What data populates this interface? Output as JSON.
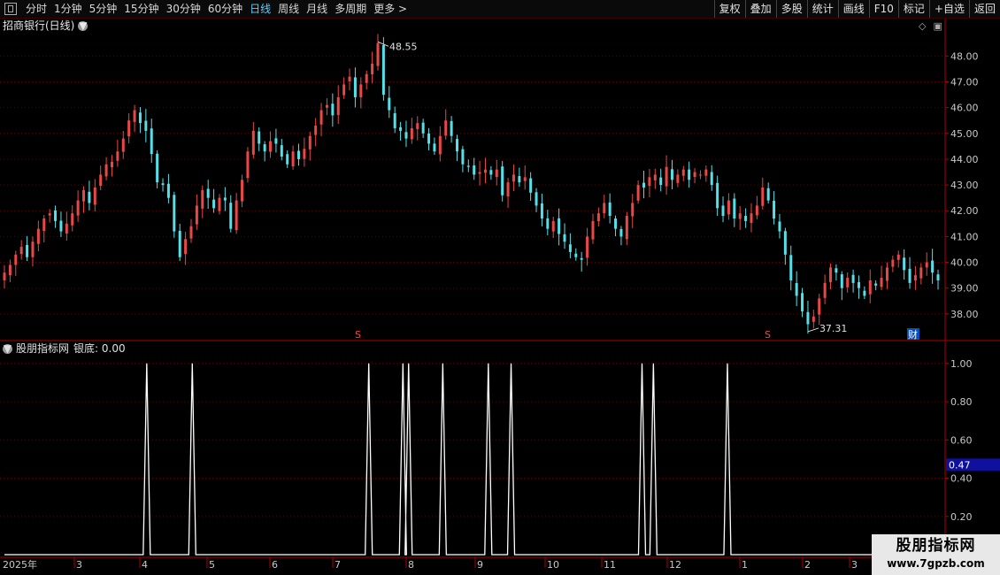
{
  "toolbar": {
    "timeframes": [
      "分时",
      "1分钟",
      "5分钟",
      "15分钟",
      "30分钟",
      "60分钟",
      "日线",
      "周线",
      "月线",
      "多周期",
      "更多 >"
    ],
    "active": "日线",
    "right_buttons": [
      "复权",
      "叠加",
      "多股",
      "统计",
      "画线",
      "F10",
      "标记",
      "+自选",
      "返回"
    ]
  },
  "chart_title": "招商银行(日线)",
  "indicator_title": "股朋指标网",
  "indicator_value_label": "银底: 0.00",
  "current_indicator_value": "0.47",
  "price_max_label": "48.55",
  "price_min_label": "37.31",
  "marker_s": "S",
  "marker_cai": "财",
  "watermark": {
    "line1": "股朋指标网",
    "line2": "www.7gpzb.com"
  },
  "colors": {
    "up": "#e84848",
    "down": "#54e0e8",
    "axis": "#b00000",
    "indicator": "#ffffff"
  },
  "chart_data": [
    {
      "type": "candlestick",
      "ylim": [
        37.0,
        48.8
      ],
      "y_ticks": [
        38.0,
        39.0,
        40.0,
        41.0,
        42.0,
        43.0,
        44.0,
        45.0,
        46.0,
        47.0,
        48.0
      ],
      "x_tick_labels": [
        "2025年",
        "3",
        "4",
        "5",
        "6",
        "7",
        "8",
        "9",
        "10",
        "11",
        "12",
        "1",
        "2",
        "3"
      ],
      "max": 48.55,
      "min": 37.31,
      "close": [
        39.6,
        39.9,
        40.3,
        40.6,
        40.2,
        40.8,
        41.3,
        41.7,
        41.9,
        41.6,
        41.2,
        41.5,
        41.9,
        42.4,
        42.8,
        42.3,
        42.9,
        43.4,
        43.8,
        43.9,
        44.3,
        44.8,
        45.5,
        45.9,
        45.4,
        45.1,
        44.2,
        43.1,
        43.0,
        42.5,
        41.2,
        40.2,
        40.9,
        41.4,
        42.2,
        42.8,
        42.5,
        42.1,
        42.5,
        42.4,
        41.3,
        42.4,
        43.2,
        44.3,
        45.1,
        44.6,
        44.3,
        44.7,
        44.6,
        44.1,
        43.8,
        44.3,
        44.0,
        44.4,
        44.9,
        45.3,
        45.9,
        46.1,
        45.7,
        46.4,
        46.9,
        47.2,
        46.4,
        46.9,
        47.3,
        47.7,
        48.5,
        46.5,
        45.9,
        45.2,
        45.1,
        44.8,
        45.2,
        45.4,
        45.0,
        44.6,
        44.3,
        44.9,
        45.5,
        44.9,
        44.3,
        43.8,
        43.7,
        43.4,
        43.5,
        43.6,
        43.4,
        43.6,
        42.6,
        43.1,
        43.4,
        43.1,
        43.3,
        42.7,
        42.2,
        41.7,
        41.3,
        41.6,
        41.1,
        40.8,
        40.4,
        40.2,
        40.1,
        41.0,
        41.6,
        41.9,
        42.3,
        41.8,
        41.3,
        41.0,
        41.8,
        42.3,
        43.0,
        42.9,
        43.3,
        43.4,
        43.0,
        43.7,
        43.2,
        43.4,
        43.6,
        43.2,
        43.5,
        43.4,
        43.6,
        43.0,
        42.1,
        41.8,
        42.4,
        41.7,
        41.9,
        41.6,
        41.9,
        42.2,
        42.9,
        42.4,
        41.7,
        41.2,
        40.3,
        39.3,
        38.7,
        38.1,
        37.6,
        37.9,
        38.6,
        39.2,
        39.8,
        39.6,
        39.0,
        39.4,
        39.2,
        39.0,
        38.7,
        39.3,
        39.1,
        39.4,
        39.8,
        40.1,
        40.3,
        39.7,
        39.2,
        39.5,
        39.8,
        40.0,
        39.6,
        39.3
      ]
    },
    {
      "type": "line",
      "name": "银底",
      "ylim": [
        0,
        1.05
      ],
      "y_ticks": [
        0.2,
        0.4,
        0.6,
        0.8,
        1.0
      ],
      "n": 165,
      "spike_indices": [
        25,
        33,
        64,
        70,
        71,
        77,
        85,
        89,
        112,
        114,
        127
      ]
    }
  ]
}
